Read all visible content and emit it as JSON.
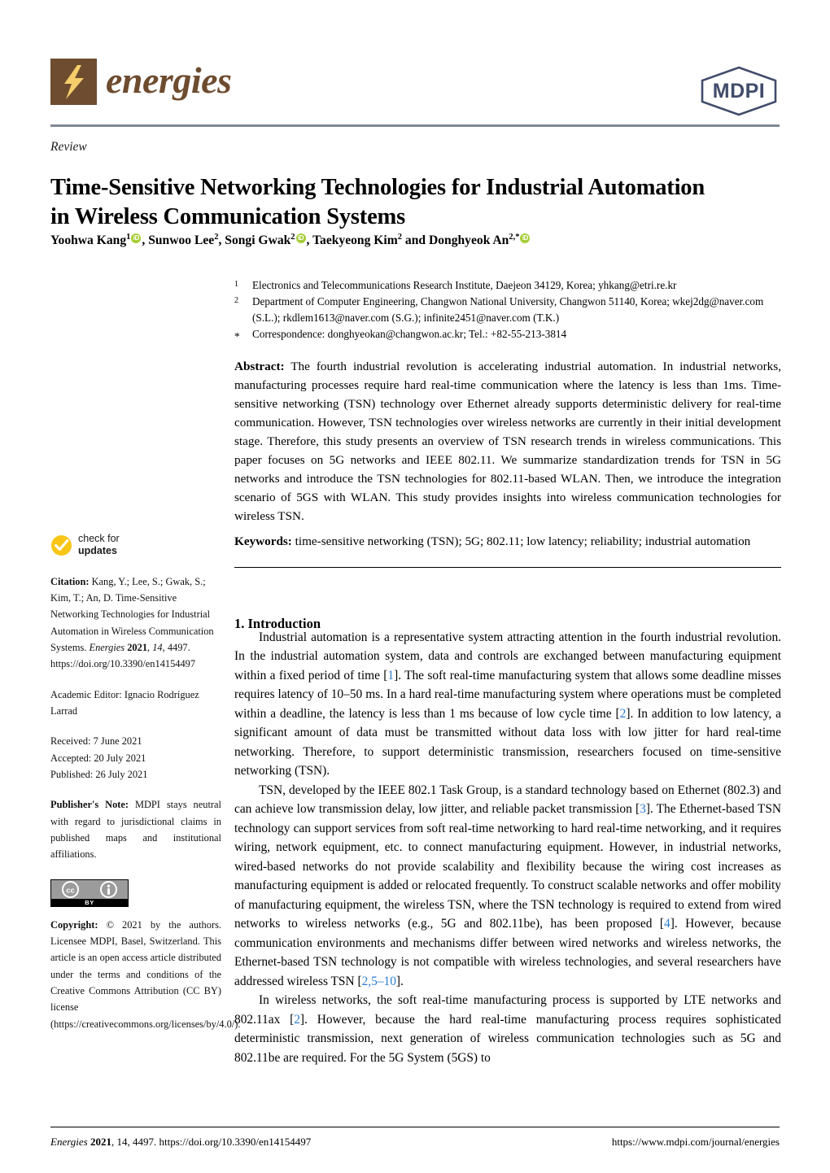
{
  "journal": {
    "name": "energies",
    "publisher_logo": "MDPI",
    "logo_icon": "lightning-bolt-icon",
    "brand_color": "#6E4C2F",
    "publisher_color": "#414C6B"
  },
  "article": {
    "type": "Review",
    "title": "Time-Sensitive Networking Technologies for Industrial Automation in Wireless Communication Systems",
    "authors_html": "Yoohwa Kang <sup>1</sup><ORCID>, Sunwoo Lee <sup>2</sup>, Songi Gwak <sup>2</sup><ORCID>, Taekyeong Kim <sup>2</sup> and Donghyeok An <sup>2,*</sup><ORCID>",
    "author_list": [
      {
        "name": "Yoohwa Kang",
        "sup": "1",
        "orcid": true
      },
      {
        "name": "Sunwoo Lee",
        "sup": "2",
        "orcid": false
      },
      {
        "name": "Songi Gwak",
        "sup": "2",
        "orcid": true
      },
      {
        "name": "Taekyeong Kim",
        "sup": "2",
        "orcid": false
      },
      {
        "name": "Donghyeok An",
        "sup": "2,*",
        "orcid": true
      }
    ],
    "authors_conjunction": "and"
  },
  "affiliations": [
    {
      "marker": "1",
      "text": "Electronics and Telecommunications Research Institute, Daejeon 34129, Korea; yhkang@etri.re.kr"
    },
    {
      "marker": "2",
      "text": "Department of Computer Engineering, Changwon National University, Changwon 51140, Korea; wkej2dg@naver.com (S.L.); rkdlem1613@naver.com (S.G.); infinite2451@naver.com (T.K.)"
    },
    {
      "marker": "*",
      "text": "Correspondence: donghyeokan@changwon.ac.kr; Tel.: +82-55-213-3814"
    }
  ],
  "abstract": {
    "label": "Abstract:",
    "text": "The fourth industrial revolution is accelerating industrial automation. In industrial networks, manufacturing processes require hard real-time communication where the latency is less than 1ms. Time-sensitive networking (TSN) technology over Ethernet already supports deterministic delivery for real-time communication. However, TSN technologies over wireless networks are currently in their initial development stage. Therefore, this study presents an overview of TSN research trends in wireless communications. This paper focuses on 5G networks and IEEE 802.11. We summarize standardization trends for TSN in 5G networks and introduce the TSN technologies for 802.11-based WLAN. Then, we introduce the integration scenario of 5GS with WLAN. This study provides insights into wireless communication technologies for wireless TSN."
  },
  "keywords": {
    "label": "Keywords:",
    "text": "time-sensitive networking (TSN); 5G; 802.11; low latency; reliability; industrial automation"
  },
  "sidebar": {
    "check_for_updates": {
      "icon": "check-circle-icon",
      "line1": "check for",
      "line2": "updates"
    },
    "citation": {
      "label": "Citation:",
      "text": "Kang, Y.; Lee, S.; Gwak, S.; Kim, T.; An, D. Time-Sensitive Networking Technologies for Industrial Automation in Wireless Communication Systems.",
      "journal_italic": "Energies",
      "year_bold": "2021",
      "volume_italic": "14",
      "article_no": "4497.",
      "doi": "https://doi.org/10.3390/en14154497"
    },
    "academic_editor": {
      "label": "Academic Editor:",
      "name": "Ignacio Rodríguez Larrad"
    },
    "dates": [
      "Received: 7 June 2021",
      "Accepted: 20 July 2021",
      "Published: 26 July 2021"
    ],
    "publishers_note": {
      "label": "Publisher's Note:",
      "text": "MDPI stays neutral with regard to jurisdictional claims in published maps and institutional affiliations."
    },
    "license_badge": {
      "icon": "creative-commons-by-icon",
      "cc_glyph": "cc",
      "by_glyph": "BY"
    },
    "copyright": {
      "label": "Copyright:",
      "text": "© 2021 by the authors. Licensee MDPI, Basel, Switzerland. This article is an open access article distributed under the terms and conditions of the Creative Commons Attribution (CC BY) license (https://creativecommons.org/licenses/by/4.0/)."
    }
  },
  "body": {
    "section_heading": "1. Introduction",
    "paragraphs": [
      [
        {
          "t": "Industrial automation is a representative system attracting attention in the fourth industrial revolution. In the industrial automation system, data and controls are exchanged between manufacturing equipment within a fixed period of time ["
        },
        {
          "t": "1",
          "cite": true
        },
        {
          "t": "]. The soft real-time manufacturing system that allows some deadline misses requires latency of 10–50 ms. In a hard real-time manufacturing system where operations must be completed within a deadline, the latency is less than 1 ms because of low cycle time ["
        },
        {
          "t": "2",
          "cite": true
        },
        {
          "t": "]. In addition to low latency, a significant amount of data must be transmitted without data loss with low jitter for hard real-time networking. Therefore, to support deterministic transmission, researchers focused on time-sensitive networking (TSN)."
        }
      ],
      [
        {
          "t": "TSN, developed by the IEEE 802.1 Task Group, is a standard technology based on Ethernet (802.3) and can achieve low transmission delay, low jitter, and reliable packet transmission ["
        },
        {
          "t": "3",
          "cite": true
        },
        {
          "t": "]. The Ethernet-based TSN technology can support services from soft real-time networking to hard real-time networking, and it requires wiring, network equipment, etc. to connect manufacturing equipment. However, in industrial networks, wired-based networks do not provide scalability and flexibility because the wiring cost increases as manufacturing equipment is added or relocated frequently. To construct scalable networks and offer mobility of manufacturing equipment, the wireless TSN, where the TSN technology is required to extend from wired networks to wireless networks (e.g., 5G and 802.11be), has been proposed ["
        },
        {
          "t": "4",
          "cite": true
        },
        {
          "t": "]. However, because communication environments and mechanisms differ between wired networks and wireless networks, the Ethernet-based TSN technology is not compatible with wireless technologies, and several researchers have addressed wireless TSN ["
        },
        {
          "t": "2,5–10",
          "cite": true
        },
        {
          "t": "]."
        }
      ],
      [
        {
          "t": "In wireless networks, the soft real-time manufacturing process is supported by LTE networks and 802.11ax ["
        },
        {
          "t": "2",
          "cite": true
        },
        {
          "t": "]. However, because the hard real-time manufacturing process requires sophisticated deterministic transmission, next generation of wireless communication technologies such as 5G and 802.11be are required. For the 5G System (5GS) to"
        }
      ]
    ]
  },
  "footer": {
    "left_journal": "Energies",
    "left_rest": "2021",
    "left_volume": ", 14, 4497. https://doi.org/10.3390/en14154497",
    "right": "https://www.mdpi.com/journal/energies"
  },
  "colors": {
    "citation_link": "#2B7CD3",
    "orcid_green": "#A6CE39",
    "check_yellow": "#F9C516",
    "rule_gray": "#7F8793"
  }
}
